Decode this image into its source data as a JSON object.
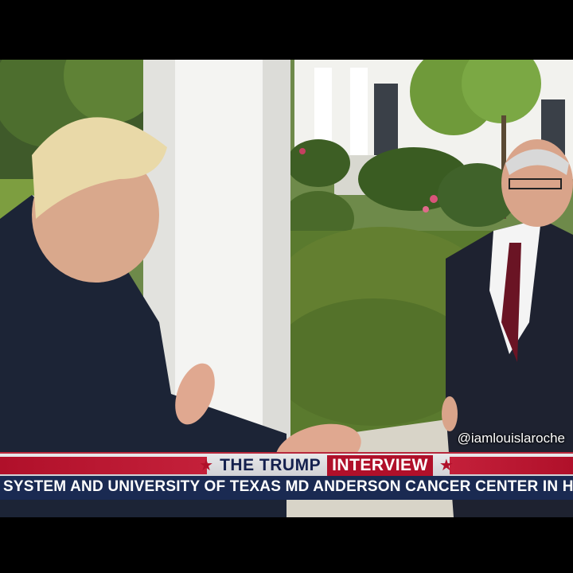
{
  "watermark": "@iamlouislaroche",
  "chyron": {
    "title_part1": "THE TRUMP",
    "title_part2": "INTERVIEW",
    "star": "★"
  },
  "ticker": "SYSTEM AND UNIVERSITY OF TEXAS MD ANDERSON CANCER CENTER IN HOUSTON",
  "colors": {
    "chyron_red": "#b0102a",
    "chyron_navy": "#14204e",
    "ticker_bg": "#1a2a52"
  }
}
